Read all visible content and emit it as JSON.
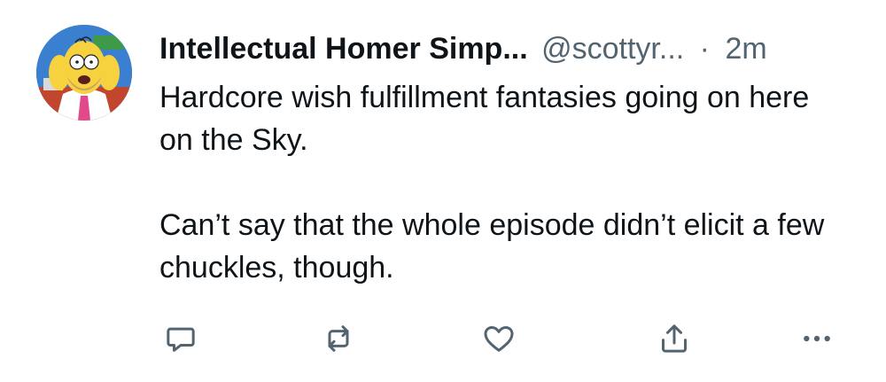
{
  "tweet": {
    "author_name": "Intellectual Homer Simp...",
    "author_handle": "@scottyr...",
    "separator": "·",
    "timestamp": "2m",
    "paragraphs": [
      "Hardcore wish fulfillment fantasies going on here on the Sky.",
      "Can’t say that the whole episode didn’t elicit a few chuckles, though."
    ]
  },
  "actions": [
    {
      "name": "reply",
      "icon": "reply-icon"
    },
    {
      "name": "retweet",
      "icon": "retweet-icon"
    },
    {
      "name": "like",
      "icon": "heart-icon"
    },
    {
      "name": "share",
      "icon": "share-icon"
    },
    {
      "name": "more",
      "icon": "more-icon"
    }
  ],
  "colors": {
    "text_primary": "#0f1419",
    "text_secondary": "#536471",
    "icon": "#536471",
    "avatar_bg": "#3a7fd0"
  }
}
